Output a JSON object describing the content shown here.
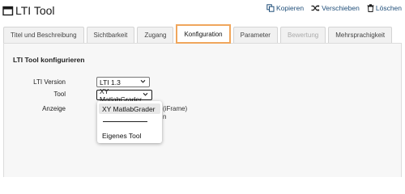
{
  "header": {
    "title": "LTI Tool",
    "actions": {
      "copy": "Kopieren",
      "move": "Verschieben",
      "delete": "Löschen"
    }
  },
  "tabs": [
    {
      "label": "Titel und Beschreibung",
      "state": "normal"
    },
    {
      "label": "Sichtbarkeit",
      "state": "normal"
    },
    {
      "label": "Zugang",
      "state": "normal"
    },
    {
      "label": "Konfiguration",
      "state": "active"
    },
    {
      "label": "Parameter",
      "state": "normal"
    },
    {
      "label": "Bewertung",
      "state": "disabled"
    },
    {
      "label": "Mehrsprachigkeit",
      "state": "normal"
    }
  ],
  "form": {
    "section_title": "LTI Tool konfigurieren",
    "lti_version": {
      "label": "LTI Version",
      "value": "LTI 1.3"
    },
    "tool": {
      "label": "Tool",
      "value": "XY MatlabGrader"
    },
    "display": {
      "label": "Anzeige",
      "visible_fragments": [
        "(iFrame)",
        "n"
      ]
    }
  },
  "dropdown": {
    "options": [
      "XY MatlabGrader",
      "—————————",
      "Eigenes Tool"
    ],
    "selected": "XY MatlabGrader"
  },
  "colors": {
    "active_tab_border": "#f0a65c",
    "link": "#1f4e79",
    "panel_bg": "#f7f7f7"
  }
}
